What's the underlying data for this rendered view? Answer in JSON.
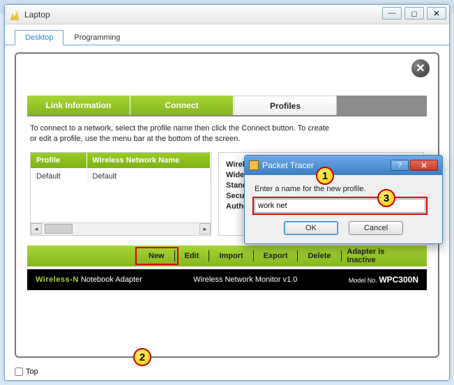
{
  "window": {
    "title": "Laptop",
    "tabs": {
      "desktop": "Desktop",
      "programming": "Programming"
    },
    "topCheckbox": "Top"
  },
  "nav": {
    "link_info": "Link Information",
    "connect": "Connect",
    "profiles": "Profiles"
  },
  "panel": {
    "instructions_line1": "To connect to a network, select the profile name then click the Connect button. To create",
    "instructions_line2": "or edit a profile, use the menu bar at the bottom of the screen.",
    "table": {
      "col_profile": "Profile",
      "col_wnn": "Wireless Network Name",
      "rows": [
        {
          "profile": "Default",
          "wnn": "Default"
        }
      ]
    },
    "details": {
      "wireless": "Wireles",
      "wide": "Wide C",
      "standard": "Standa",
      "security": "Securit",
      "auth": "Authen"
    }
  },
  "actions": {
    "new": "New",
    "edit": "Edit",
    "import": "Import",
    "export": "Export",
    "delete": "Delete",
    "status": "Adapter is Inactive"
  },
  "footer": {
    "brand_strong": "Wireless-N",
    "brand_rest": " Notebook Adapter",
    "monitor": "Wireless Network Monitor  v1.0",
    "model_label": "Model No.",
    "model": "WPC300N"
  },
  "dialog": {
    "title": "Packet Tracer",
    "prompt": "Enter a name for the new profile.",
    "value": "work net",
    "ok": "OK",
    "cancel": "Cancel",
    "help": "?",
    "close": "✕"
  },
  "markers": {
    "m1": "1",
    "m2": "2",
    "m3": "3"
  }
}
